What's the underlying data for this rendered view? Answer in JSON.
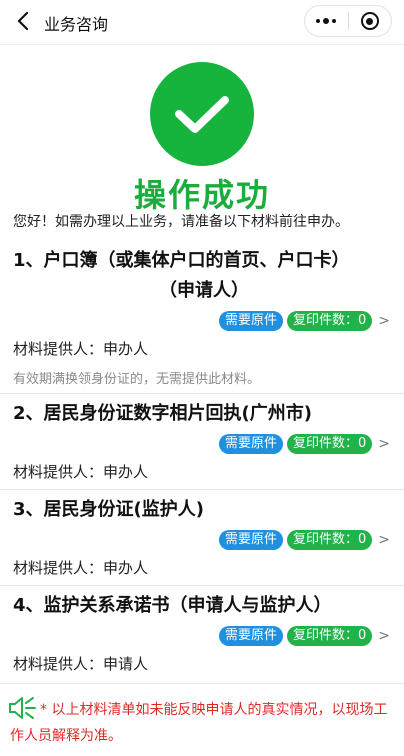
{
  "nav": {
    "title": "业务咨询",
    "back_icon": "chevron-left-icon",
    "more_icon": "more-dots-icon",
    "close_icon": "target-close-icon"
  },
  "result": {
    "icon": "check-icon",
    "title": "操作成功",
    "intro": "您好！如需办理以上业务，请准备以下材料前往申办。",
    "accent": "#16b33d"
  },
  "materials": [
    {
      "title_line1": "1、户口簿（或集体户口的首页、户口卡）",
      "title_line2": "（申请人）",
      "need_label": "需要原件",
      "copy_label": "复印件数：0",
      "provider": "材料提供人：申办人",
      "note": "有效期满换领身份证的，无需提供此材料。"
    },
    {
      "title_line1": "2、居民身份证数字相片回执(广州市)",
      "need_label": "需要原件",
      "copy_label": "复印件数：0",
      "provider": "材料提供人：申办人"
    },
    {
      "title_line1": "3、居民身份证(监护人)",
      "need_label": "需要原件",
      "copy_label": "复印件数：0",
      "provider": "材料提供人：申办人"
    },
    {
      "title_line1": "4、监护关系承诺书（申请人与监护人）",
      "need_label": "需要原件",
      "copy_label": "复印件数：0",
      "provider": "材料提供人：申请人"
    }
  ],
  "footer": {
    "icon": "speaker-icon",
    "note": "* 以上材料清单如未能反映申请人的真实情况，以现场工作人员解释为准。",
    "color": "#e02a2a"
  },
  "colors": {
    "need_badge": "#1f8fe0",
    "copy_badge": "#21b34a"
  }
}
